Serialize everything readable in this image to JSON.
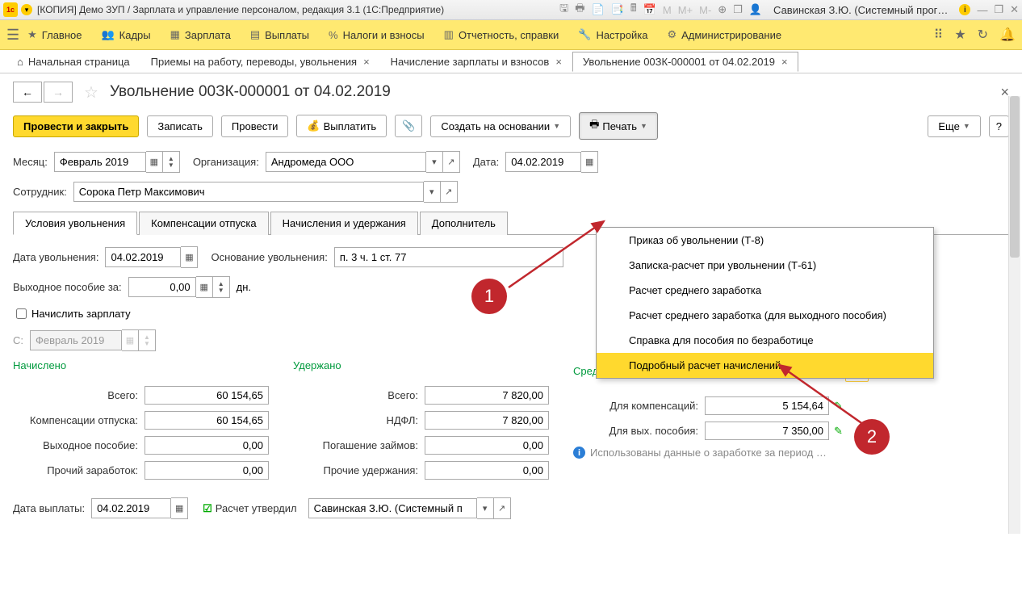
{
  "titlebar": {
    "title": "[КОПИЯ] Демо ЗУП / Зарплата и управление персоналом, редакция 3.1  (1С:Предприятие)",
    "user": "Савинская З.Ю. (Системный прог…"
  },
  "menu": {
    "items": [
      "Главное",
      "Кадры",
      "Зарплата",
      "Выплаты",
      "Налоги и взносы",
      "Отчетность, справки",
      "Настройка",
      "Администрирование"
    ]
  },
  "tabs": {
    "home": "Начальная страница",
    "items": [
      "Приемы на работу, переводы, увольнения",
      "Начисление зарплаты и взносов",
      "Увольнение 00ЗК-000001 от 04.02.2019"
    ],
    "active_index": 2
  },
  "page": {
    "title": "Увольнение 00ЗК-000001 от 04.02.2019",
    "close_x": "×"
  },
  "toolbar": {
    "post_close": "Провести и закрыть",
    "write": "Записать",
    "post": "Провести",
    "pay": "Выплатить",
    "create_based": "Создать на основании",
    "print": "Печать",
    "more": "Еще",
    "help": "?"
  },
  "form": {
    "month_label": "Месяц:",
    "month_value": "Февраль 2019",
    "org_label": "Организация:",
    "org_value": "Андромеда ООО",
    "date_label": "Дата:",
    "date_value": "04.02.2019",
    "employee_label": "Сотрудник:",
    "employee_value": "Сорока Петр Максимович"
  },
  "subtabs": [
    "Условия увольнения",
    "Компенсации отпуска",
    "Начисления и удержания",
    "Дополнитель"
  ],
  "dismissal": {
    "date_label": "Дата увольнения:",
    "date_value": "04.02.2019",
    "basis_label": "Основание увольнения:",
    "basis_value": "п. 3 ч. 1 ст. 77",
    "severance_label": "Выходное пособие за:",
    "severance_value": "0,00",
    "severance_unit": "дн.",
    "accrue_salary": "Начислить зарплату",
    "from_label": "С:",
    "from_value": "Февраль 2019"
  },
  "columns": {
    "accrued": {
      "title": "Начислено",
      "total_label": "Всего:",
      "total_value": "60 154,65",
      "comp_label": "Компенсации отпуска:",
      "comp_value": "60 154,65",
      "sev_label": "Выходное пособие:",
      "sev_value": "0,00",
      "other_label": "Прочий заработок:",
      "other_value": "0,00"
    },
    "withheld": {
      "title": "Удержано",
      "total_label": "Всего:",
      "total_value": "7 820,00",
      "ndfl_label": "НДФЛ:",
      "ndfl_value": "7 820,00",
      "loan_label": "Погашение займов:",
      "loan_value": "0,00",
      "other_label": "Прочие удержания:",
      "other_value": "0,00"
    },
    "average": {
      "title": "Средний заработок",
      "comp_label": "Для компенсаций:",
      "comp_value": "5 154,64",
      "sev_label": "Для вых. пособия:",
      "sev_value": "7 350,00",
      "info": "Использованы данные о заработке за период …"
    }
  },
  "footer": {
    "payout_date_label": "Дата выплаты:",
    "payout_date_value": "04.02.2019",
    "approved_label": "Расчет утвердил",
    "approved_by": "Савинская З.Ю. (Системный п"
  },
  "print_menu": {
    "items": [
      "Приказ об увольнении (Т-8)",
      "Записка-расчет при увольнении (Т-61)",
      "Расчет среднего заработка",
      "Расчет среднего заработка (для выходного пособия)",
      "Справка для пособия по безработице",
      "Подробный расчет начислений"
    ],
    "highlight_index": 5
  },
  "annotations": {
    "one": "1",
    "two": "2"
  }
}
